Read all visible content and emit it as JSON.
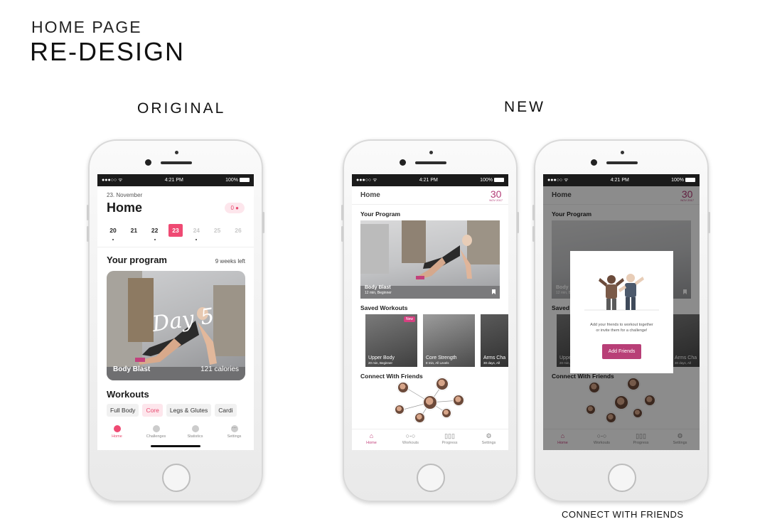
{
  "slide": {
    "title_small": "HOME PAGE",
    "title_large": "RE-DESIGN",
    "heading_original": "ORIGINAL",
    "heading_new": "NEW",
    "caption": "CONNECT WITH FRIENDS"
  },
  "status": {
    "left": "●●●○○ ᯤ",
    "time": "4:21 PM",
    "battery": "100%"
  },
  "original": {
    "date": "23. November",
    "title": "Home",
    "pill": "0 ●",
    "days": [
      "20",
      "21",
      "22",
      "23",
      "24",
      "25",
      "26"
    ],
    "program_heading": "Your program",
    "weeks_left": "9 weeks left",
    "card_script": "Day 5",
    "card_title": "Body Blast",
    "card_calories": "121 calories",
    "workouts_heading": "Workouts",
    "chips": [
      "Full Body",
      "Core",
      "Legs & Glutes",
      "Cardi"
    ],
    "tabs": [
      "Home",
      "Challenges",
      "Statistics",
      "Settings"
    ]
  },
  "new": {
    "header_title": "Home",
    "date_num": "30",
    "date_month": "NOV 2017",
    "program_heading": "Your Program",
    "hero_title": "Body Blast",
    "hero_sub": "12 min, Beginner",
    "saved_heading": "Saved Workouts",
    "saved": [
      {
        "title": "Upper Body",
        "sub": "20 min, Beginner",
        "badge": "New"
      },
      {
        "title": "Core Strength",
        "sub": "8 min, All Levels",
        "badge": ""
      },
      {
        "title": "Arms Cha",
        "sub": "30 days, All",
        "badge": ""
      }
    ],
    "connect_heading": "Connect With Friends",
    "tabs": [
      "Home",
      "Workouts",
      "Progress",
      "Settings"
    ],
    "tab_icons": [
      "⌂",
      "○-○",
      "▯▯▯",
      "⚙"
    ]
  },
  "modal": {
    "text_line1": "Add your friends to workout together",
    "text_line2": "or invite them for a challenge!",
    "button": "Add Friends"
  },
  "colors": {
    "accent_pink": "#ef4a73",
    "accent_magenta": "#b23a75"
  }
}
